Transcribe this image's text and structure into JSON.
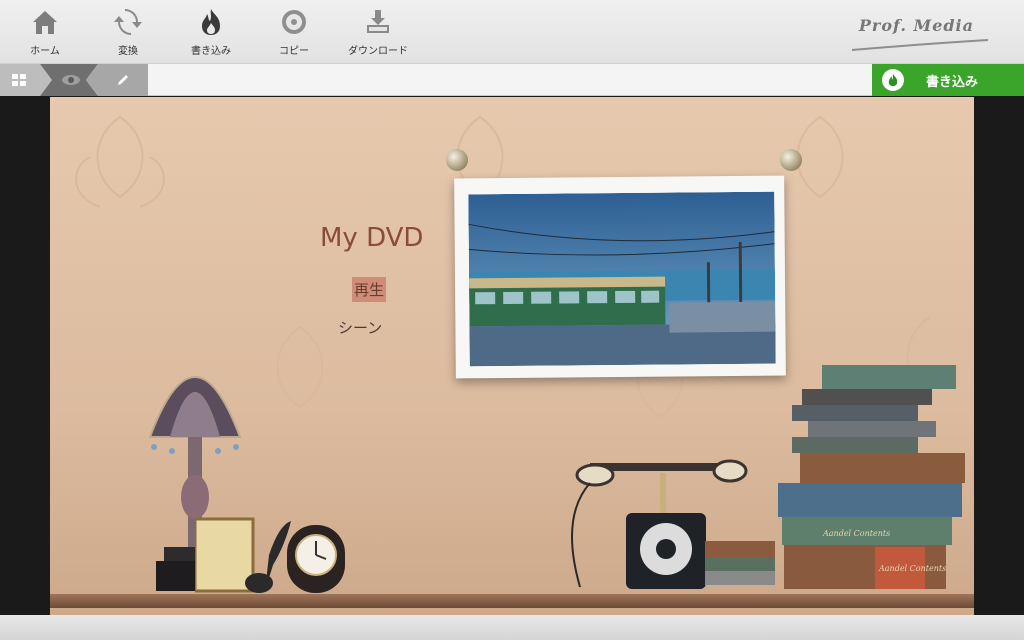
{
  "toolbar": {
    "items": [
      {
        "label": "ホーム",
        "icon": "home-icon"
      },
      {
        "label": "変換",
        "icon": "convert-icon"
      },
      {
        "label": "書き込み",
        "icon": "burn-icon"
      },
      {
        "label": "コピー",
        "icon": "copy-icon"
      },
      {
        "label": "ダウンロード",
        "icon": "download-icon"
      }
    ],
    "brand": "Prof. Media"
  },
  "subbar": {
    "tabs": [
      {
        "icon": "grid-view-icon"
      },
      {
        "icon": "preview-eye-icon",
        "active": true
      },
      {
        "icon": "edit-pencil-icon"
      }
    ],
    "burn_button_label": "書き込み",
    "burn_button_color": "#3aa52a"
  },
  "menu": {
    "title": "My DVD",
    "play_label": "再生",
    "scene_label": "シーン"
  },
  "book_spines": [
    "Aandel Contents",
    "Aandel Contents"
  ]
}
